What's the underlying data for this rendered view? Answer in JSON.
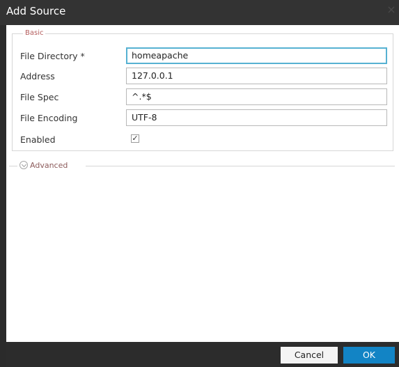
{
  "dialog": {
    "title": "Add Source",
    "close_label": "×"
  },
  "basic": {
    "legend": "Basic",
    "fields": [
      {
        "label": "File Directory *",
        "value": "homeapache"
      },
      {
        "label": "Address",
        "value": "127.0.0.1"
      },
      {
        "label": "File Spec",
        "value": "^.*$"
      },
      {
        "label": "File Encoding",
        "value": "UTF-8"
      },
      {
        "label": "Enabled",
        "checked": true
      }
    ],
    "enabled_mark": "✓"
  },
  "advanced": {
    "label": "Advanced"
  },
  "footer": {
    "cancel_label": "Cancel",
    "ok_label": "OK"
  },
  "colors": {
    "accent": "#1284c5",
    "focus_border": "#56b1d2",
    "title_bar": "#333333"
  }
}
